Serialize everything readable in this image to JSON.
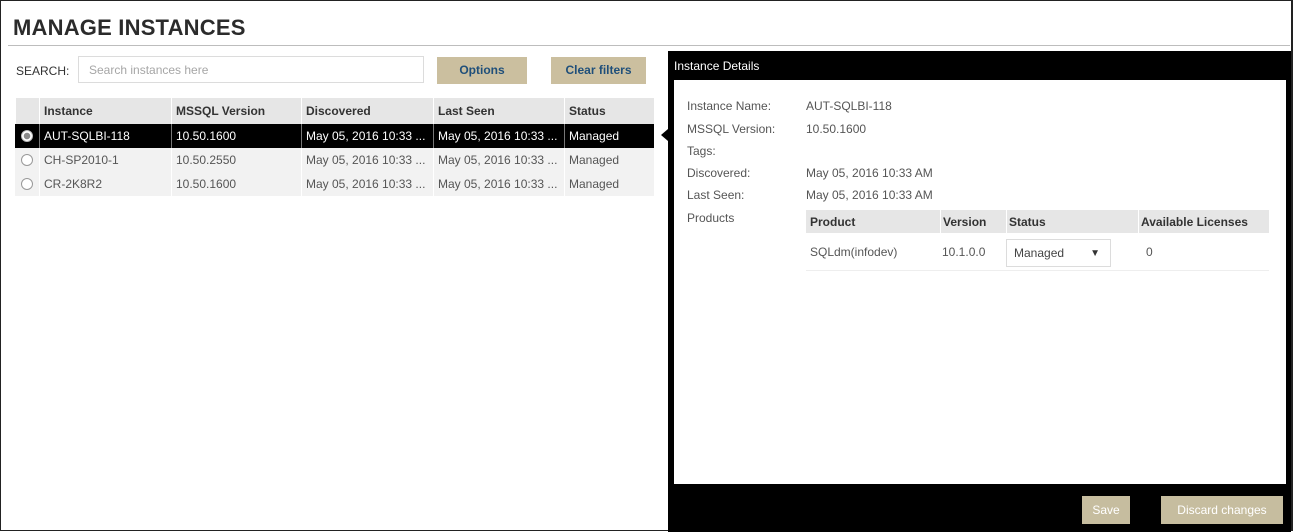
{
  "page": {
    "title": "MANAGE INSTANCES"
  },
  "search": {
    "label": "SEARCH:",
    "placeholder": "Search instances here",
    "value": ""
  },
  "toolbar": {
    "options_label": "Options",
    "clear_filters_label": "Clear filters"
  },
  "grid": {
    "columns": [
      "Instance",
      "MSSQL Version",
      "Discovered",
      "Last Seen",
      "Status"
    ],
    "rows": [
      {
        "selected": true,
        "instance": "AUT-SQLBI-118",
        "version": "10.50.1600",
        "discovered": "May 05, 2016 10:33 ...",
        "last_seen": "May 05, 2016 10:33 ...",
        "status": "Managed"
      },
      {
        "selected": false,
        "instance": "CH-SP2010-1",
        "version": "10.50.2550",
        "discovered": "May 05, 2016 10:33 ...",
        "last_seen": "May 05, 2016 10:33 ...",
        "status": "Managed"
      },
      {
        "selected": false,
        "instance": "CR-2K8R2",
        "version": "10.50.1600",
        "discovered": "May 05, 2016 10:33 ...",
        "last_seen": "May 05, 2016 10:33 ...",
        "status": "Managed"
      }
    ]
  },
  "details": {
    "header": "Instance Details",
    "instance_name_label": "Instance Name:",
    "instance_name": "AUT-SQLBI-118",
    "mssql_version_label": "MSSQL Version:",
    "mssql_version": "10.50.1600",
    "tags_label": "Tags:",
    "discovered_label": "Discovered:",
    "discovered": "May 05, 2016 10:33 AM",
    "last_seen_label": "Last Seen:",
    "last_seen": "May 05, 2016 10:33 AM",
    "products_label": "Products",
    "products_columns": [
      "Product",
      "Version",
      "Status",
      "Available Licenses"
    ],
    "products": [
      {
        "product": "SQLdm(infodev)",
        "version": "10.1.0.0",
        "status": "Managed",
        "available_licenses": "0"
      }
    ],
    "save_label": "Save",
    "discard_label": "Discard changes"
  },
  "colors": {
    "button_tan": "#cbbf9f",
    "button_text": "#1f4f7a",
    "panel_black": "#000000",
    "header_gray": "#e6e6e6"
  },
  "icons": {
    "select_caret": "caret-down-icon",
    "row_radio": "radio-icon"
  }
}
